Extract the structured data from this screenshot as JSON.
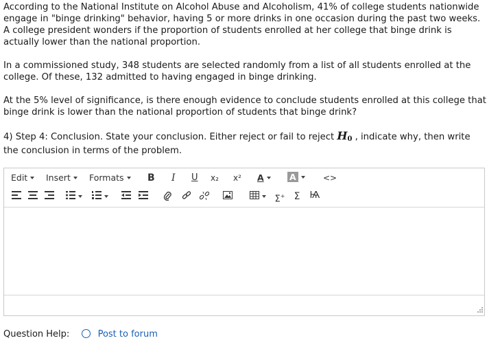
{
  "question": {
    "p1": "According to the National Institute on Alcohol Abuse and Alcoholism, 41% of college students nationwide engage in \"binge drinking\" behavior, having 5 or more drinks in one occasion during the past two weeks. A college president wonders if the proportion of students enrolled at her college that binge drink is actually lower than the national proportion.",
    "p2": "In a commissioned study, 348 students are selected randomly from a list of all students enrolled at the college. Of these, 132 admitted to having engaged in binge drinking.",
    "p3": "At the 5% level of significance, is there enough evidence to conclude students enrolled at this college that binge drink is lower than the national proportion of students that binge drink?",
    "p4_before": "4) Step 4: Conclusion.  State your conclusion.  Either reject or fail to reject ",
    "h0_letter": "H",
    "h0_sub": "0",
    "p4_after": " , indicate why, then write the conclusion in terms of the problem."
  },
  "toolbar": {
    "edit": "Edit",
    "insert": "Insert",
    "formats": "Formats",
    "bold": "B",
    "italic": "I",
    "underline": "U",
    "subscript": "x₂",
    "superscript": "x²",
    "font_color": "A",
    "bg_color": "A",
    "code": "<>"
  },
  "icons": [
    "align-left-icon",
    "align-center-icon",
    "align-right-icon",
    "bullet-list-icon",
    "numbered-list-icon",
    "outdent-icon",
    "indent-icon",
    "attach-icon",
    "link-icon",
    "unlink-icon",
    "image-icon",
    "table-icon",
    "sum-plus-icon",
    "sigma-icon",
    "special-char-icon"
  ],
  "help": {
    "label": "Question Help:",
    "link": "Post to forum"
  },
  "colors": {
    "link": "#1a5fb4",
    "text": "#1a1a1a",
    "border": "#c8c8c8"
  }
}
